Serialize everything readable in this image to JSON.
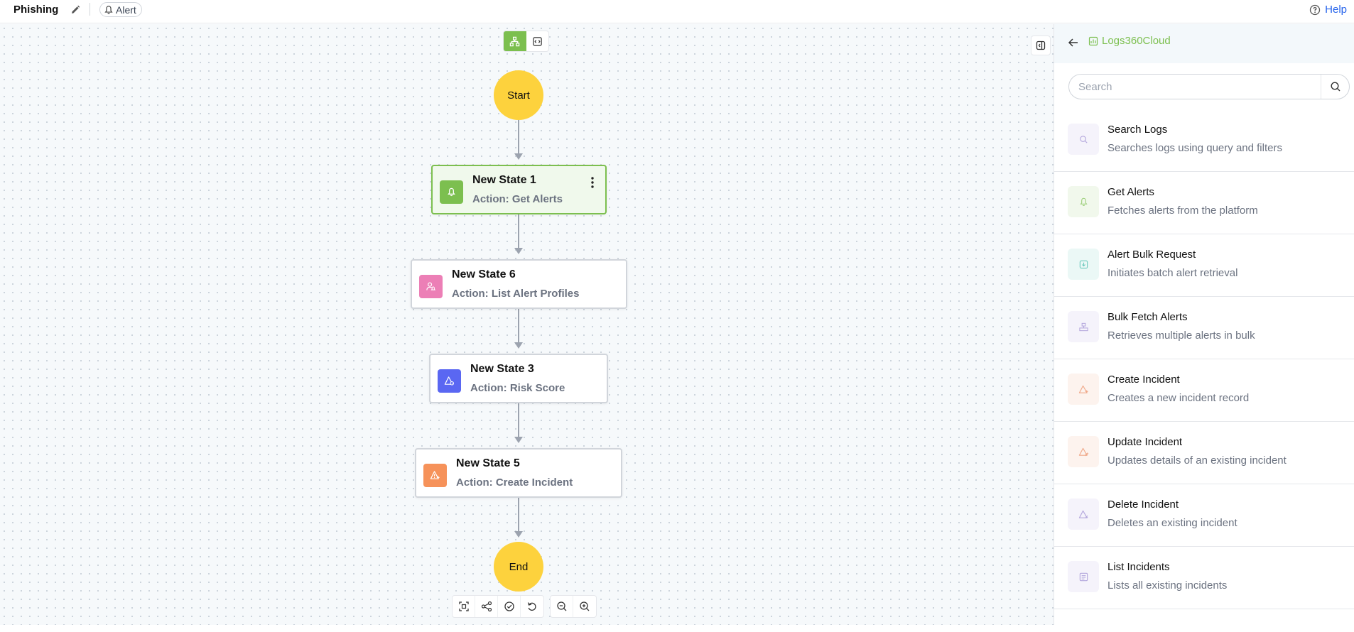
{
  "header": {
    "title": "Phishing",
    "edit_icon": "pencil-icon",
    "tag_label": "Alert",
    "help_label": "Help"
  },
  "canvas": {
    "start_label": "Start",
    "end_label": "End",
    "nodes": [
      {
        "name": "New State 1",
        "action": "Action: Get Alerts",
        "color": "#7cbf4f",
        "selected": true
      },
      {
        "name": "New State 6",
        "action": "Action: List Alert Profiles",
        "color": "#ec7fb6",
        "selected": false
      },
      {
        "name": "New State 3",
        "action": "Action: Risk Score",
        "color": "#5a67f2",
        "selected": false
      },
      {
        "name": "New State 5",
        "action": "Action: Create Incident",
        "color": "#f6925a",
        "selected": false
      }
    ],
    "view_toggle": [
      "workflow-view-icon",
      "code-view-icon"
    ],
    "toolbar": [
      "fit-view-icon",
      "auto-layout-icon",
      "validate-icon",
      "reset-icon",
      "zoom-out-icon",
      "zoom-in-icon"
    ]
  },
  "panel": {
    "title": "Logs360Cloud",
    "search_placeholder": "Search",
    "actions": [
      {
        "name": "Search Logs",
        "desc": "Searches logs using query and filters",
        "tint": "#f5f3fb",
        "icon_color": "#b3a6dc"
      },
      {
        "name": "Get Alerts",
        "desc": "Fetches alerts from the platform",
        "tint": "#f1f8ec",
        "icon_color": "#9fd07e"
      },
      {
        "name": "Alert Bulk Request",
        "desc": "Initiates batch alert retrieval",
        "tint": "#ebf8f6",
        "icon_color": "#6fcbbf"
      },
      {
        "name": "Bulk Fetch Alerts",
        "desc": "Retrieves multiple alerts in bulk",
        "tint": "#f5f3fb",
        "icon_color": "#b3a6dc"
      },
      {
        "name": "Create Incident",
        "desc": "Creates a new incident record",
        "tint": "#fdf3ee",
        "icon_color": "#f0a98a"
      },
      {
        "name": "Update Incident",
        "desc": "Updates details of an existing incident",
        "tint": "#fdf3ee",
        "icon_color": "#f0a98a"
      },
      {
        "name": "Delete Incident",
        "desc": "Deletes an existing incident",
        "tint": "#f5f3fb",
        "icon_color": "#b3a6dc"
      },
      {
        "name": "List Incidents",
        "desc": "Lists all existing incidents",
        "tint": "#f5f3fb",
        "icon_color": "#b3a6dc"
      }
    ]
  }
}
